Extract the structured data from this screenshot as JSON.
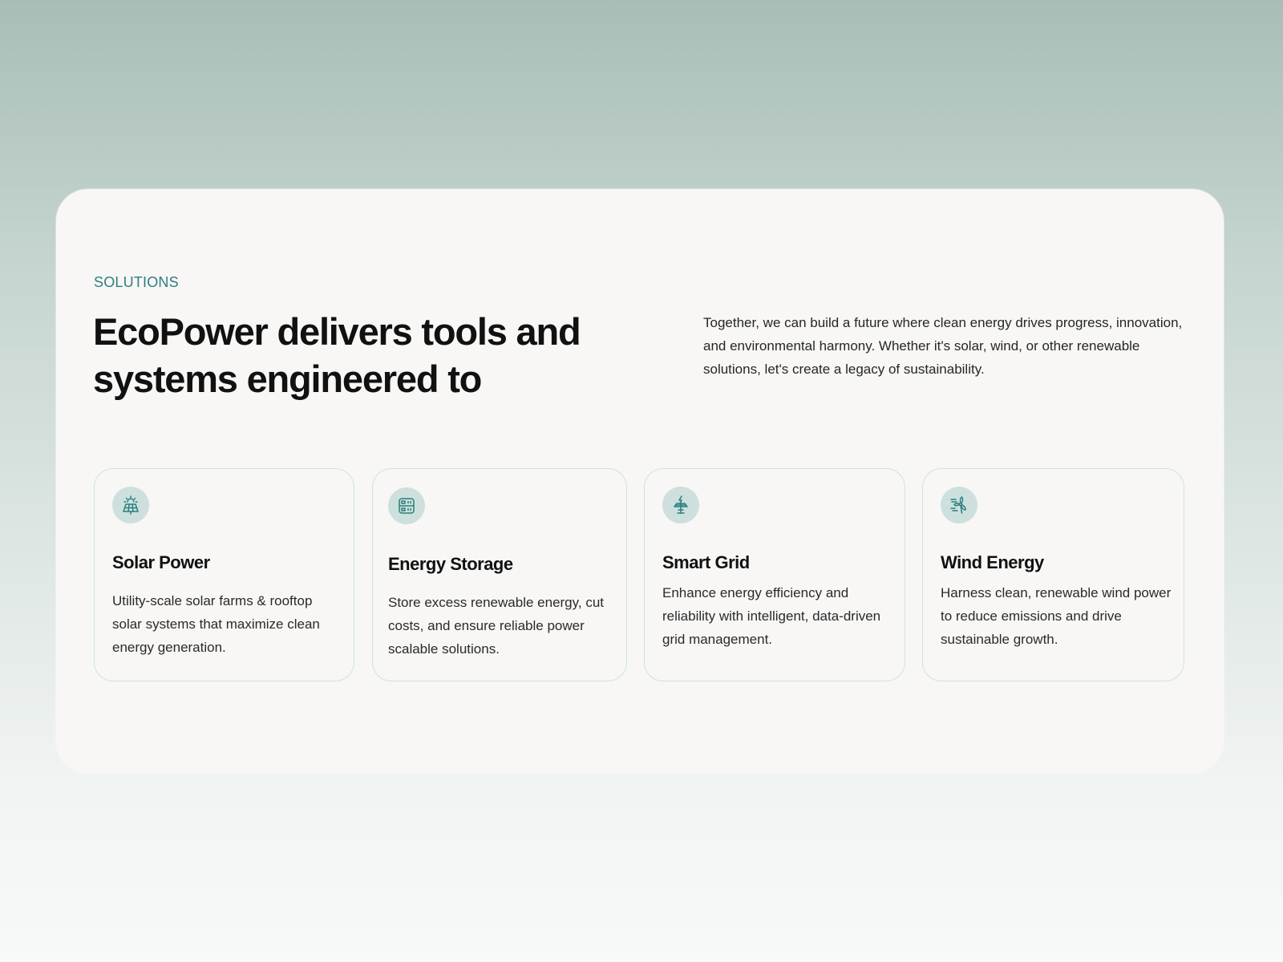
{
  "section": {
    "eyebrow": "SOLUTIONS",
    "headline": "EcoPower delivers tools and systems engineered to",
    "intro": "Together, we can build a future where clean energy drives progress, innovation, and environmental harmony. Whether it's solar, wind, or other renewable solutions, let's create a legacy of sustainability."
  },
  "cards": [
    {
      "icon": "solar-panel-icon",
      "title": "Solar Power",
      "description": "Utility-scale solar farms & rooftop solar systems that maximize clean energy generation."
    },
    {
      "icon": "battery-storage-icon",
      "title": "Energy Storage",
      "description": "Store excess renewable energy, cut costs, and ensure reliable power scalable solutions."
    },
    {
      "icon": "smart-grid-icon",
      "title": "Smart Grid",
      "description": "Enhance energy efficiency and reliability with intelligent, data-driven grid management."
    },
    {
      "icon": "wind-turbine-icon",
      "title": "Wind Energy",
      "description": "Harness clean, renewable wind power to reduce emissions and drive sustainable growth."
    }
  ],
  "colors": {
    "accent": "#2b7f7e",
    "icon_bg": "#cde0dd",
    "card_border": "#cfe3df",
    "panel_bg": "#f8f7f6"
  }
}
